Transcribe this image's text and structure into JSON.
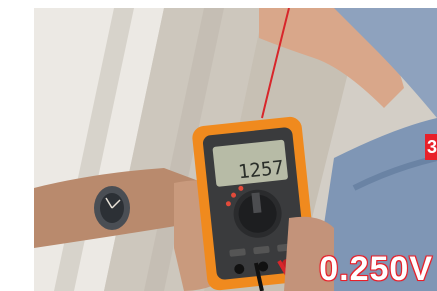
{
  "overlay": {
    "reading": "0.250V",
    "badge": "3"
  },
  "display": {
    "lcd_value": "1257"
  },
  "icons": {
    "multimeter": "multimeter-icon",
    "watch": "wristwatch-icon",
    "probe": "probe-icon"
  },
  "colors": {
    "overlay_red": "#e8202a",
    "meter_orange": "#f08a1e",
    "lead_red": "#d8262b"
  }
}
